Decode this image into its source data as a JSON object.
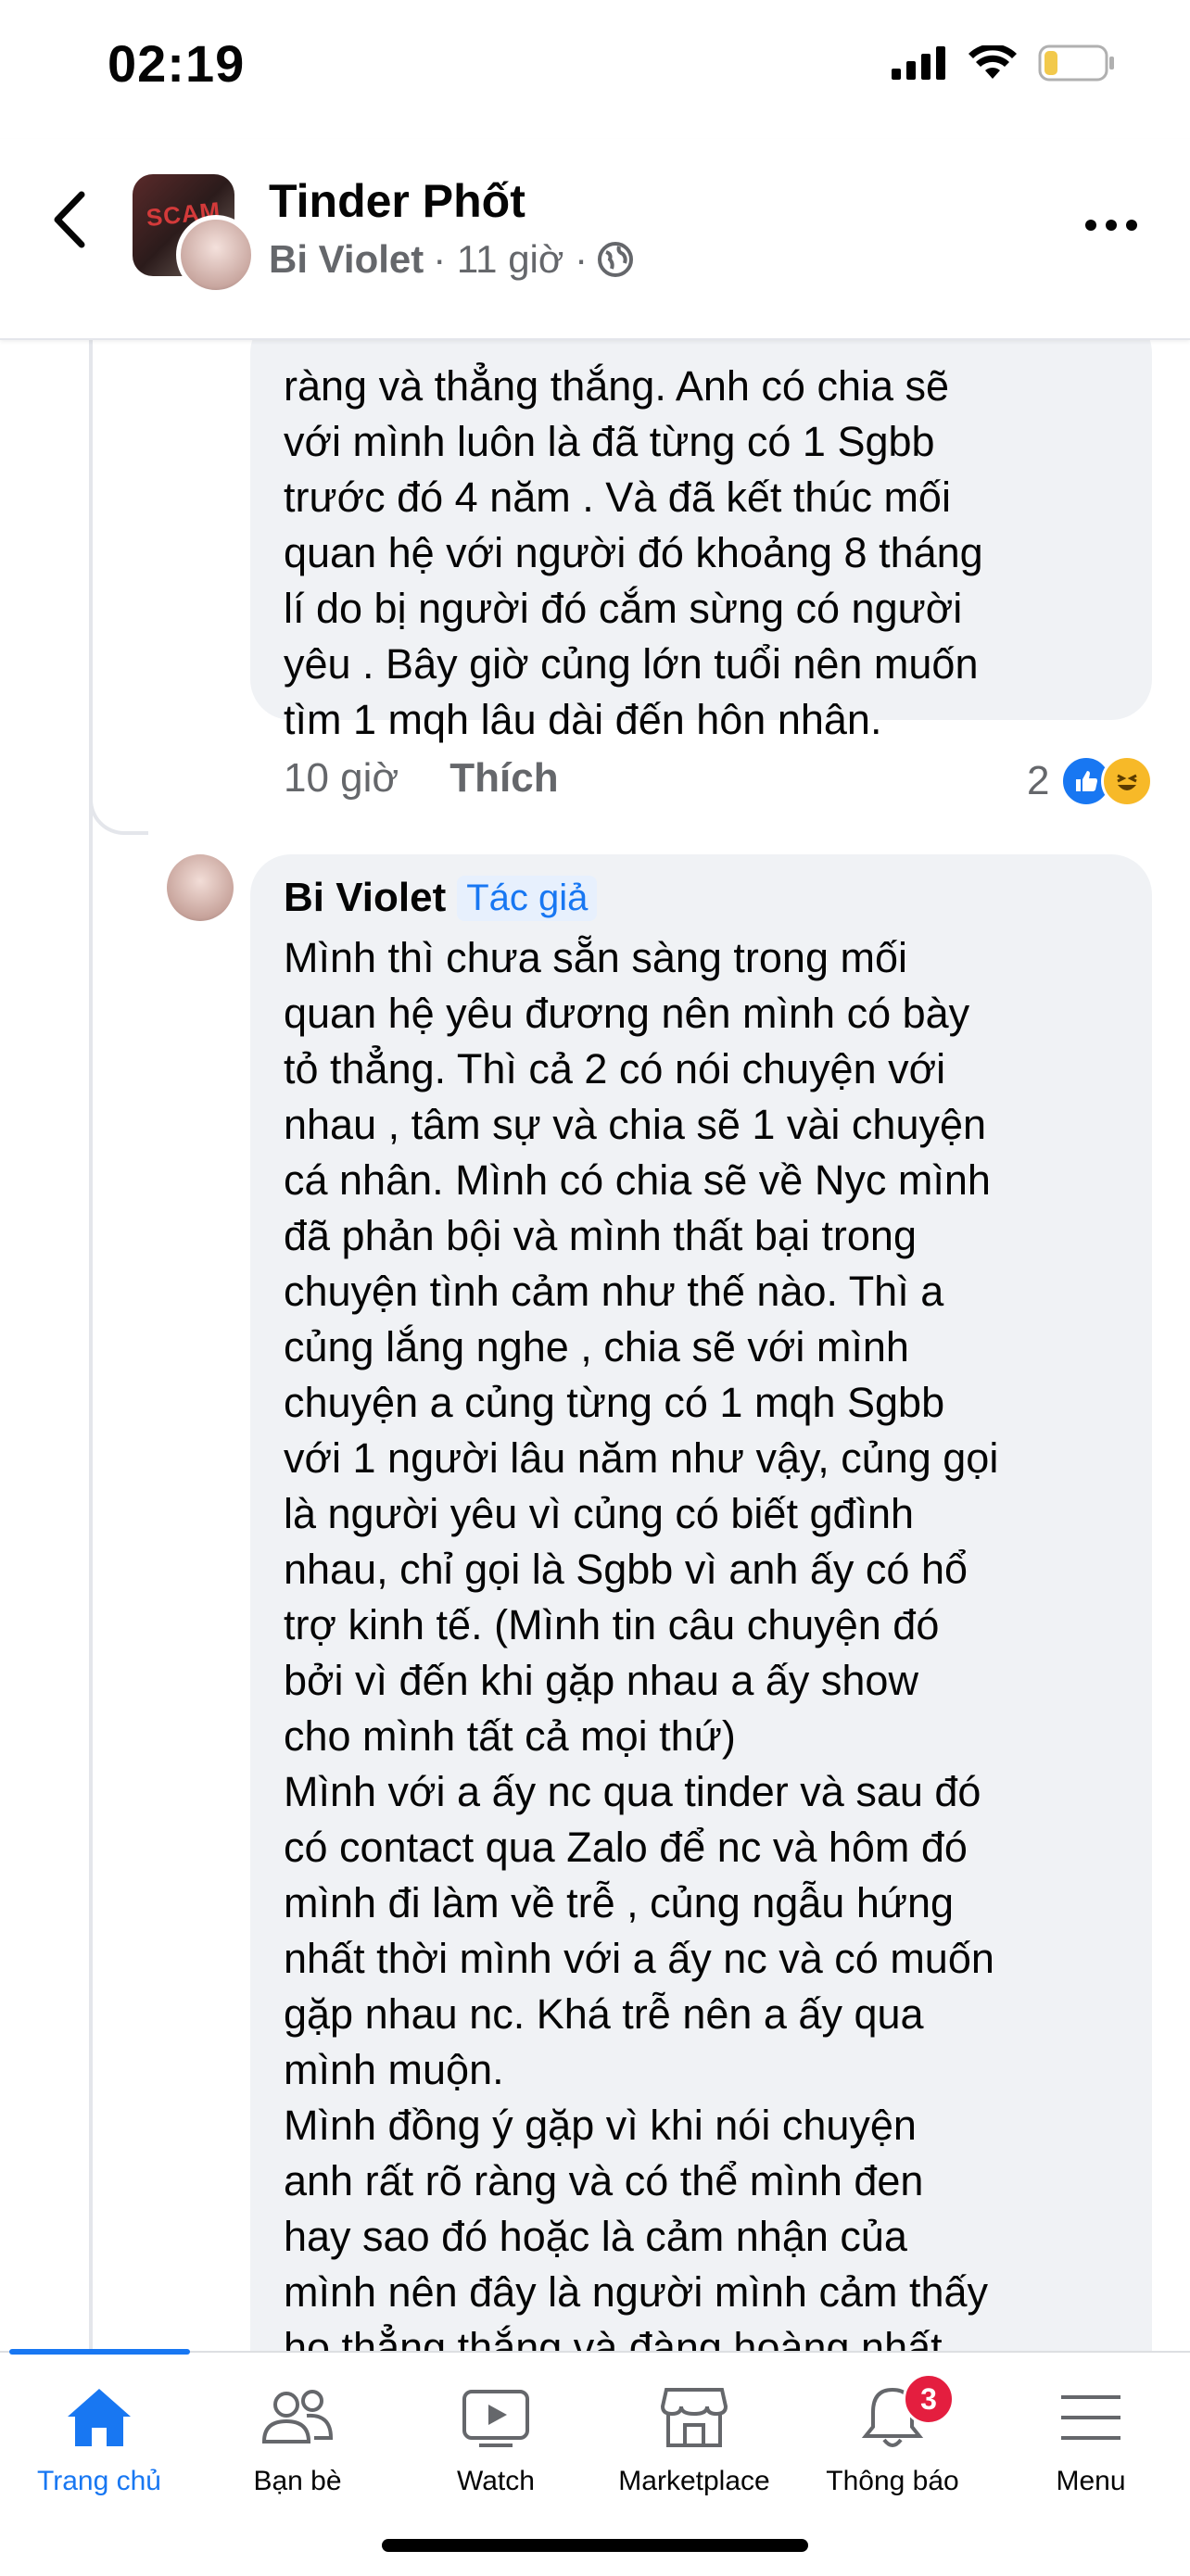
{
  "status": {
    "time": "02:19"
  },
  "header": {
    "group_name": "Tinder Phốt",
    "group_avatar_text": "SCAM",
    "poster": "Bi Violet",
    "time": "· 11 giờ ·"
  },
  "comment1": {
    "text": "ràng và thẳng thắng. Anh có chia sẽ\nvới mình luôn là đã từng có 1 Sgbb\ntrước đó 4 năm . Và đã kết thúc mối\nquan hệ với người đó khoảng 8 tháng\nlí do bị người đó cắm sừng có người\nyêu . Bây giờ củng lớn tuổi nên muốn\ntìm 1 mqh lâu dài đến hôn nhân.",
    "time": "10 giờ",
    "like_label": "Thích",
    "reaction_count": "2"
  },
  "comment2": {
    "author": "Bi Violet",
    "badge": "Tác giả",
    "text": "Mình thì chưa sẵn sàng trong mối\nquan hệ yêu đương nên mình có bày\ntỏ thẳng. Thì cả 2 có nói chuyện với\nnhau , tâm sự và chia sẽ 1 vài chuyện\ncá nhân. Mình có chia sẽ về Nyc mình\nđã phản bội và mình thất bại trong\nchuyện tình cảm như thế nào. Thì a\ncủng lắng nghe , chia sẽ với mình\nchuyện a củng từng có 1 mqh Sgbb\nvới 1 người lâu năm như vậy, củng gọi\nlà người yêu vì củng có biết gđình\nnhau, chỉ gọi là Sgbb vì anh ấy có hổ\ntrợ kinh tế. (Mình tin câu chuyện đó\nbởi vì đến khi gặp nhau a ấy show\ncho mình tất cả mọi thứ)\nMình với a ấy nc qua tinder và sau đó\ncó contact qua Zalo để nc và hôm đó\nmình đi làm về trễ , củng ngẫu hứng\nnhất thời mình với a ấy nc và có muốn\ngặp nhau nc. Khá trễ nên a ấy qua\nmình muộn.\nMình đồng ý gặp vì khi nói chuyện\nanh rất rõ ràng và có thể mình đen\nhay sao đó hoặc là cảm nhận của\nmình nên đây là người mình cảm thấy\nhọ thẳng thắng và đàng hoàng nhất"
  },
  "nav": {
    "items": [
      {
        "label": "Trang chủ",
        "icon": "home-icon"
      },
      {
        "label": "Bạn bè",
        "icon": "friends-icon"
      },
      {
        "label": "Watch",
        "icon": "watch-icon"
      },
      {
        "label": "Marketplace",
        "icon": "marketplace-icon"
      },
      {
        "label": "Thông báo",
        "icon": "bell-icon",
        "badge": "3"
      },
      {
        "label": "Menu",
        "icon": "menu-icon"
      }
    ]
  },
  "colors": {
    "accent": "#1877f2",
    "bubble": "#f0f2f5",
    "secondary_text": "#65676b",
    "badge_red": "#e41e3f"
  }
}
